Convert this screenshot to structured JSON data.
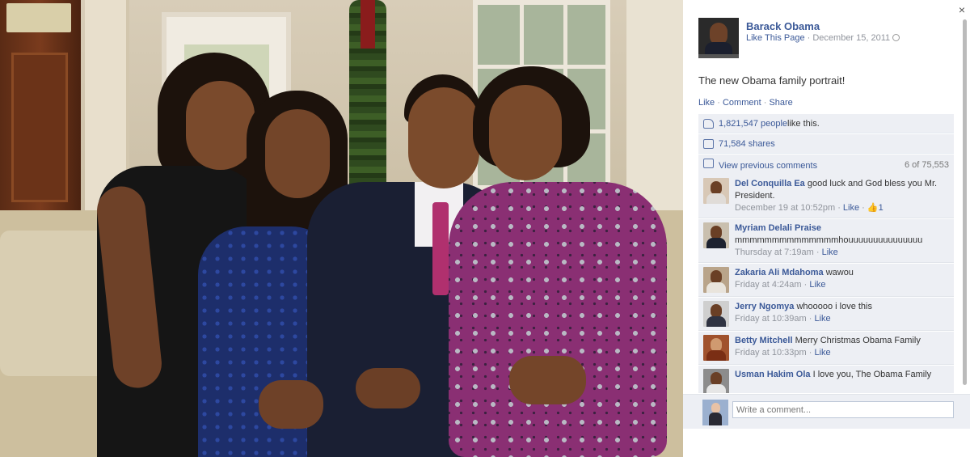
{
  "post": {
    "page_name": "Barack Obama",
    "like_page": "Like This Page",
    "separator": " · ",
    "date": "December 15, 2011",
    "text": "The new Obama family portrait!",
    "actions": {
      "like": "Like",
      "comment": "Comment",
      "share": "Share"
    }
  },
  "ufi": {
    "likes_count": "1,821,547 people",
    "likes_suffix": " like this.",
    "shares": "71,584 shares",
    "view_previous": "View previous comments",
    "comment_count": "6 of 75,553"
  },
  "comments": [
    {
      "name": "Del Conquilla Ea",
      "text": "good luck and God bless you Mr. President.",
      "time": "December 19 at 10:52pm",
      "like": "Like",
      "likes": "1"
    },
    {
      "name": "Myriam Delali Praise",
      "text": "mmmmmmmmmmmmmmhouuuuuuuuuuuuuuu",
      "time": "Thursday at 7:19am",
      "like": "Like"
    },
    {
      "name": "Zakaria Ali Mdahoma",
      "text": "wawou",
      "time": "Friday at 4:24am",
      "like": "Like"
    },
    {
      "name": "Jerry Ngomya",
      "text": "whooooo i love this",
      "time": "Friday at 10:39am",
      "like": "Like"
    },
    {
      "name": "Betty Mitchell",
      "text": "Merry Christmas Obama Family",
      "time": "Friday at 10:33pm",
      "like": "Like"
    },
    {
      "name": "Usman Hakim Ola",
      "text": "I love you, The Obama Family",
      "time": "",
      "like": ""
    }
  ],
  "composer": {
    "placeholder": "Write a comment..."
  },
  "colors": {
    "link": "#3b5998",
    "panel_bg": "#edeff4"
  },
  "icons": [
    "close-icon",
    "globe-icon",
    "thumbs-up-icon",
    "share-icon",
    "comment-bubble-icon"
  ]
}
